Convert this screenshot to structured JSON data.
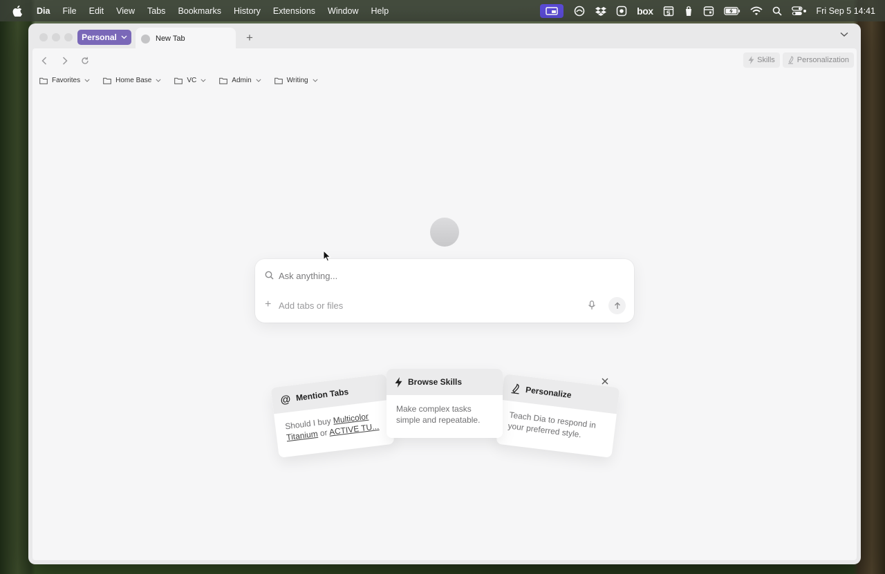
{
  "menubar": {
    "app_name": "Dia",
    "menus": [
      "File",
      "Edit",
      "View",
      "Tabs",
      "Bookmarks",
      "History",
      "Extensions",
      "Window",
      "Help"
    ],
    "tray": {
      "box_label": "box",
      "clock": "Fri Sep 5  14:41"
    }
  },
  "window": {
    "profile_label": "Personal",
    "tab_title": "New Tab",
    "new_tab_symbol": "+"
  },
  "toolbar": {
    "skills_label": "Skills",
    "personalization_label": "Personalization"
  },
  "bookmarks": [
    {
      "label": "Favorites"
    },
    {
      "label": "Home Base"
    },
    {
      "label": "VC"
    },
    {
      "label": "Admin"
    },
    {
      "label": "Writing"
    }
  ],
  "search": {
    "placeholder": "Ask anything...",
    "add_label": "Add tabs or files"
  },
  "cards": {
    "mention": {
      "title": "Mention Tabs",
      "body_prefix": "Should I buy ",
      "link1": "Multicolor Titanium",
      "body_mid": " or ",
      "link2": "ACTIVE TU..."
    },
    "skills": {
      "title": "Browse Skills",
      "body": "Make complex tasks simple and repeatable."
    },
    "personalize": {
      "title": "Personalize",
      "body": "Teach Dia to respond in your preferred style."
    }
  },
  "colors": {
    "profile_accent": "#7a68b8",
    "tray_active": "#5b4bd6"
  }
}
